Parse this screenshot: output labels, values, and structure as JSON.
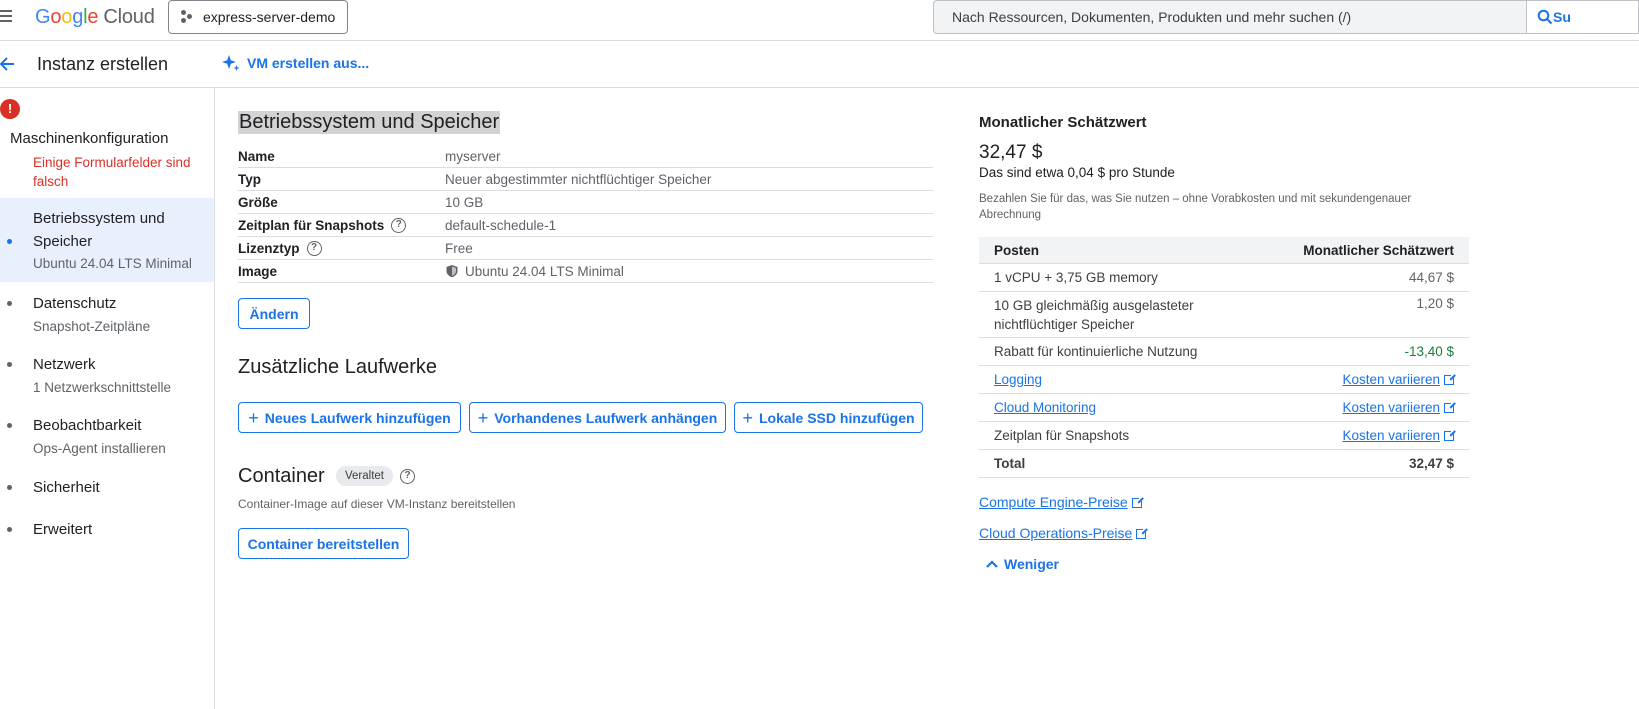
{
  "topbar": {
    "logo": {
      "letters": [
        "G",
        "o",
        "o",
        "g",
        "l",
        "e"
      ],
      "suffix": "Cloud"
    },
    "project": "express-server-demo",
    "search_placeholder": "Nach Ressourcen, Dokumenten, Produkten und mehr suchen (/)",
    "search_button": "Su"
  },
  "subheader": {
    "title": "Instanz erstellen",
    "ai_link": "VM erstellen aus..."
  },
  "sidebar": {
    "machine_config": "Maschinenkonfiguration",
    "machine_config_error": "Einige Formularfelder sind falsch",
    "items": [
      {
        "label": "Betriebssystem und Speicher",
        "sub": "Ubuntu 24.04 LTS Minimal"
      },
      {
        "label": "Datenschutz",
        "sub": "Snapshot-Zeitpläne"
      },
      {
        "label": "Netzwerk",
        "sub": "1 Netzwerkschnittstelle"
      },
      {
        "label": "Beobachtbarkeit",
        "sub": "Ops-Agent installieren"
      },
      {
        "label": "Sicherheit"
      },
      {
        "label": "Erweitert"
      }
    ]
  },
  "os_section": {
    "title": "Betriebssystem und Speicher",
    "rows": [
      {
        "key": "Name",
        "value": "myserver"
      },
      {
        "key": "Typ",
        "value": "Neuer abgestimmter nichtflüchtiger Speicher"
      },
      {
        "key": "Größe",
        "value": "10 GB"
      },
      {
        "key": "Zeitplan für Snapshots",
        "value": "default-schedule-1"
      },
      {
        "key": "Lizenztyp",
        "value": "Free"
      },
      {
        "key": "Image",
        "value": "Ubuntu 24.04 LTS Minimal"
      }
    ],
    "change_button": "Ändern"
  },
  "drives_section": {
    "title": "Zusätzliche Laufwerke",
    "buttons": [
      "Neues Laufwerk hinzufügen",
      "Vorhandenes Laufwerk anhängen",
      "Lokale SSD hinzufügen"
    ]
  },
  "container_section": {
    "title": "Container",
    "badge": "Veraltet",
    "description": "Container-Image auf dieser VM-Instanz bereitstellen",
    "button": "Container bereitstellen"
  },
  "estimate": {
    "title": "Monatlicher Schätzwert",
    "price": "32,47 $",
    "per_hour": "Das sind etwa 0,04 $ pro Stunde",
    "description": "Bezahlen Sie für das, was Sie nutzen – ohne Vorabkosten und mit sekundengenauer Abrechnung",
    "table_header": {
      "item": "Posten",
      "amount": "Monatlicher Schätzwert"
    },
    "rows": [
      {
        "item": "1 vCPU + 3,75 GB memory",
        "amount": "44,67 $"
      },
      {
        "item": "10 GB gleichmäßig ausgelasteter nichtflüchtiger Speicher",
        "amount": "1,20 $"
      },
      {
        "item": "Rabatt für kontinuierliche Nutzung",
        "amount": "-13,40 $"
      },
      {
        "item": "Logging",
        "amount": "Kosten variieren"
      },
      {
        "item": "Cloud Monitoring",
        "amount": "Kosten variieren"
      },
      {
        "item": "Zeitplan für Snapshots",
        "amount": "Kosten variieren"
      },
      {
        "item": "Total",
        "amount": "32,47 $"
      }
    ],
    "links": [
      "Compute Engine-Preise",
      "Cloud Operations-Preise"
    ],
    "less": "Weniger"
  }
}
